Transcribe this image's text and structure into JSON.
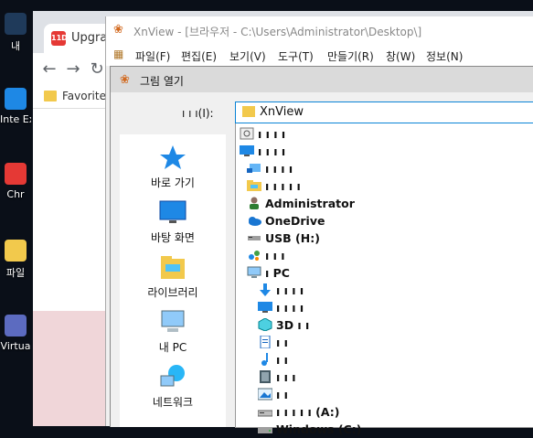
{
  "desktop": {
    "icons": [
      {
        "label": "내",
        "color": "#1f3a5a"
      },
      {
        "label": "Inte Exp",
        "color": "#1e88e5"
      },
      {
        "label": "Chr",
        "color": "#e53935"
      },
      {
        "label": "파일",
        "color": "#f2c94c"
      },
      {
        "label": "Virtua",
        "color": "#5c6bc0"
      }
    ]
  },
  "chrome": {
    "tab_title": "Upgrad",
    "tab_favicon": "11D",
    "bookmark_label": "Favorites"
  },
  "xnview": {
    "title": "XnView - [브라우저 - C:\\Users\\Administrator\\Desktop\\]",
    "menu": [
      "파일(F)",
      "편집(E)",
      "보기(V)",
      "도구(T)",
      "만들기(R)",
      "창(W)",
      "정보(N)"
    ]
  },
  "dialog": {
    "title": "그림 열기",
    "lookin_label": "ı ı ı(I):",
    "lookin_value": "XnView",
    "places": [
      {
        "label": "바로 가기",
        "icon": "star-icon"
      },
      {
        "label": "바탕 화면",
        "icon": "desktop-icon"
      },
      {
        "label": "라이브러리",
        "icon": "library-icon"
      },
      {
        "label": "내 PC",
        "icon": "computer-icon"
      },
      {
        "label": "네트워크",
        "icon": "network-icon"
      }
    ],
    "items": [
      {
        "label": "ı ı ı ı",
        "icon": "recent-icon",
        "indent": 0
      },
      {
        "label": "ı ı ı ı",
        "icon": "desktop-icon",
        "indent": 0
      },
      {
        "label": "ı ı ı ı",
        "icon": "network-share-icon",
        "indent": 1
      },
      {
        "label": "ı ı ı ı ı",
        "icon": "folder-icon",
        "indent": 1
      },
      {
        "label": "Administrator",
        "icon": "user-icon",
        "indent": 1
      },
      {
        "label": "OneDrive",
        "icon": "cloud-icon",
        "indent": 1
      },
      {
        "label": "USB (H:)",
        "icon": "usb-drive-icon",
        "indent": 1
      },
      {
        "label": "ı ı ı",
        "icon": "homegroup-icon",
        "indent": 1
      },
      {
        "label": "ı PC",
        "icon": "computer-icon",
        "indent": 1
      },
      {
        "label": "ı ı ı ı",
        "icon": "download-icon",
        "indent": 2
      },
      {
        "label": "ı ı ı ı",
        "icon": "desktop-icon",
        "indent": 2
      },
      {
        "label": "3D  ı ı",
        "icon": "3d-objects-icon",
        "indent": 2
      },
      {
        "label": "ı ı",
        "icon": "document-icon",
        "indent": 2
      },
      {
        "label": "ı ı",
        "icon": "music-icon",
        "indent": 2
      },
      {
        "label": "ı ı ı",
        "icon": "video-icon",
        "indent": 2
      },
      {
        "label": "ı ı",
        "icon": "picture-icon",
        "indent": 2
      },
      {
        "label": "ı ı ı ı ı (A:)",
        "icon": "floppy-drive-icon",
        "indent": 2
      },
      {
        "label": "Windows (C:)",
        "icon": "hard-drive-icon",
        "indent": 2
      }
    ]
  },
  "colors": {
    "selection": "#0a84d6",
    "folder": "#f2c94c",
    "icon_blue": "#1e88e5"
  }
}
